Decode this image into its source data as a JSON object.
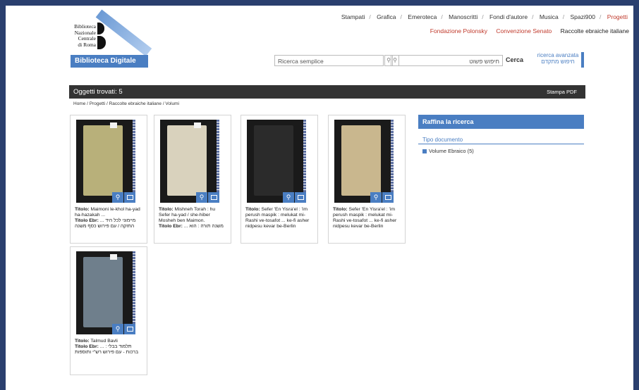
{
  "logo": {
    "lines": [
      "Biblioteca",
      "Nazionale",
      "Centrale",
      "di Roma"
    ],
    "banner": "Biblioteca Digitale"
  },
  "topnav": [
    "Stampati",
    "Grafica",
    "Emeroteca",
    "Manoscritti",
    "Fondi d'autore",
    "Musica",
    "Spazi900",
    "Progetti"
  ],
  "subnav": {
    "links": [
      "Fondazione Polonsky",
      "Convenzione Senato"
    ],
    "current": "Raccolte ebraiche italiane"
  },
  "search": {
    "simple_placeholder": "Ricerca semplice",
    "hebrew_placeholder": "חיפוש פשוט",
    "button": "Cerca",
    "advanced": "ricerca avanzata",
    "advanced_hebrew": "חיפוש מתקדם"
  },
  "results": {
    "label": "Oggetti trovati: 5",
    "print": "Stampa PDF"
  },
  "breadcrumb": "Home / Progetti / Raccolte ebraiche italiane / Volumi",
  "cards": [
    {
      "title_label": "Titolo:",
      "title": "Maimoni le-khol ha-yad ha-hazakah ...",
      "heb_label": "Titolo Ebr:",
      "heb": "... מיימוני לכל היד החזקה / עם פירוש כסף משנה",
      "book_color": "#b8b07a"
    },
    {
      "title_label": "Titolo:",
      "title": "Mishneh Torah : hu Sefer ha-yad / she-hiber Mosheh ben Maimon.",
      "heb_label": "Titolo Ebr:",
      "heb": "... משנה תורה : הוא",
      "book_color": "#d9d2bd"
    },
    {
      "title_label": "Titolo:",
      "title": "Sefer 'En Yisra'el : 'im perush maspik : melukat mi-Rashi ve-tosafot ... ke-fi asher nidpesu kevar be-Berlin",
      "heb_label": "",
      "heb": "",
      "book_color": "#2b2b2b"
    },
    {
      "title_label": "Titolo:",
      "title": "Sefer 'En Yisra'el : 'im perush maspik : melukat mi-Rashi ve-tosafot ... ke-fi asher nidpesu kevar be-Berlin",
      "heb_label": "",
      "heb": "",
      "book_color": "#c9b78e"
    },
    {
      "title_label": "Titolo:",
      "title": "Talmud Bavli",
      "heb_label": "Titolo Ebr:",
      "heb": "... תלמוד בבלי : ברכות - עם פירוש רש\"י ותוספות",
      "book_color": "#6f7f8c"
    }
  ],
  "sidebar": {
    "title": "Raffina la ricerca",
    "section": "Tipo documento",
    "facet": "Volume Ebraico (5)"
  },
  "colors": {
    "accent": "#4a7ec2",
    "nav_active": "#c0392b",
    "dark_bar": "#333333"
  }
}
